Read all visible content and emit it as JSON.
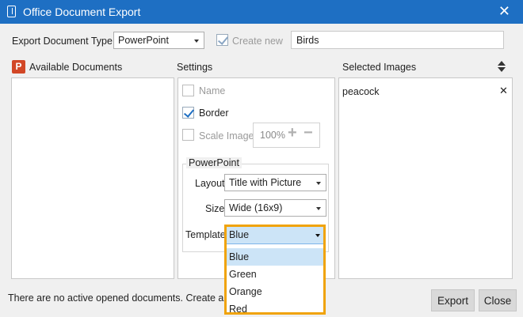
{
  "window": {
    "title": "Office Document Export"
  },
  "export_type": {
    "label": "Export Document Type",
    "value": "PowerPoint"
  },
  "create_new": {
    "label": "Create new",
    "checked": true,
    "enabled": false
  },
  "document_name": {
    "value": "Birds"
  },
  "available_documents": {
    "header": "Available Documents",
    "icon": "powerpoint-icon",
    "icon_letter": "P"
  },
  "settings": {
    "header": "Settings",
    "name_label": "Name",
    "border_label": "Border",
    "scale_images_label": "Scale Images",
    "scale_value": "100%",
    "powerpoint_group": "PowerPoint",
    "layout_label": "Layout",
    "layout_value": "Title with Picture",
    "size_label": "Size",
    "size_value": "Wide (16x9)",
    "template_label": "Template",
    "template_value": "Blue",
    "template_options": [
      "Blue",
      "Green",
      "Orange",
      "Red"
    ]
  },
  "selected_images": {
    "header": "Selected Images",
    "items": [
      "peacock"
    ]
  },
  "status": {
    "text": "There are no active opened documents. Create a new"
  },
  "buttons": {
    "export": "Export",
    "close": "Close"
  },
  "colors": {
    "titlebar": "#1e6fc3",
    "highlight": "#f0a30a",
    "selection": "#cce4f7"
  }
}
